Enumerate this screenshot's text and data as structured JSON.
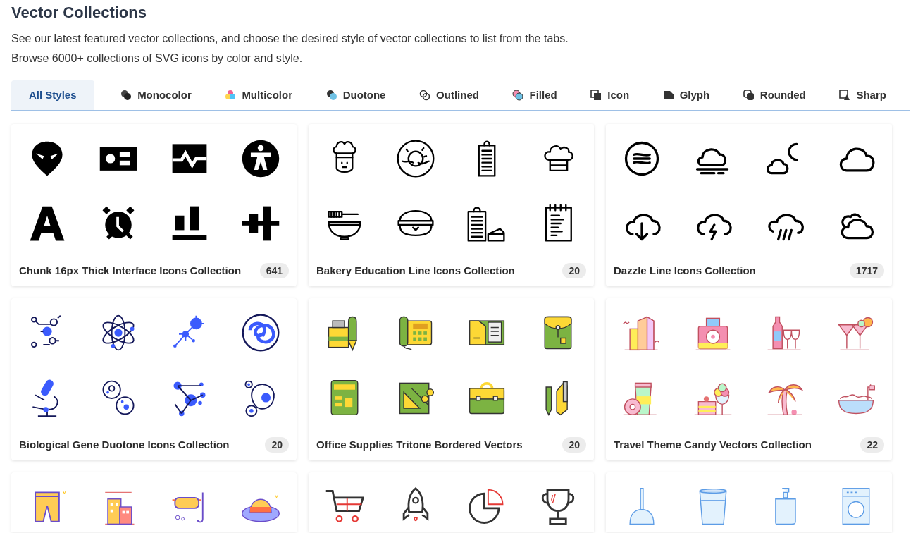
{
  "page": {
    "title": "Vector Collections",
    "description": [
      "See our latest featured vector collections, and choose the desired style of vector collections to list from the tabs.",
      "Browse 6000+ collections of SVG icons by color and style."
    ]
  },
  "tabs": [
    {
      "label": "All Styles",
      "selected": true
    },
    {
      "label": "Monocolor",
      "selected": false
    },
    {
      "label": "Multicolor",
      "selected": false
    },
    {
      "label": "Duotone",
      "selected": false
    },
    {
      "label": "Outlined",
      "selected": false
    },
    {
      "label": "Filled",
      "selected": false
    },
    {
      "label": "Icon",
      "selected": false
    },
    {
      "label": "Glyph",
      "selected": false
    },
    {
      "label": "Rounded",
      "selected": false
    },
    {
      "label": "Sharp",
      "selected": false
    }
  ],
  "collections": [
    {
      "kind": "full",
      "title": "Chunk 16px Thick Interface Icons Collection",
      "count": "641"
    },
    {
      "kind": "full",
      "title": "Bakery Education Line Icons Collection",
      "count": "20"
    },
    {
      "kind": "full",
      "title": "Dazzle Line Icons Collection",
      "count": "1717"
    },
    {
      "kind": "full",
      "title": "Biological Gene Duotone Icons Collection",
      "count": "20"
    },
    {
      "kind": "full",
      "title": "Office Supplies Tritone Bordered Vectors",
      "count": "20"
    },
    {
      "kind": "full",
      "title": "Travel Theme Candy Vectors Collection",
      "count": "22"
    },
    {
      "kind": "cut_off"
    },
    {
      "kind": "cut_off"
    },
    {
      "kind": "cut_off"
    }
  ]
}
